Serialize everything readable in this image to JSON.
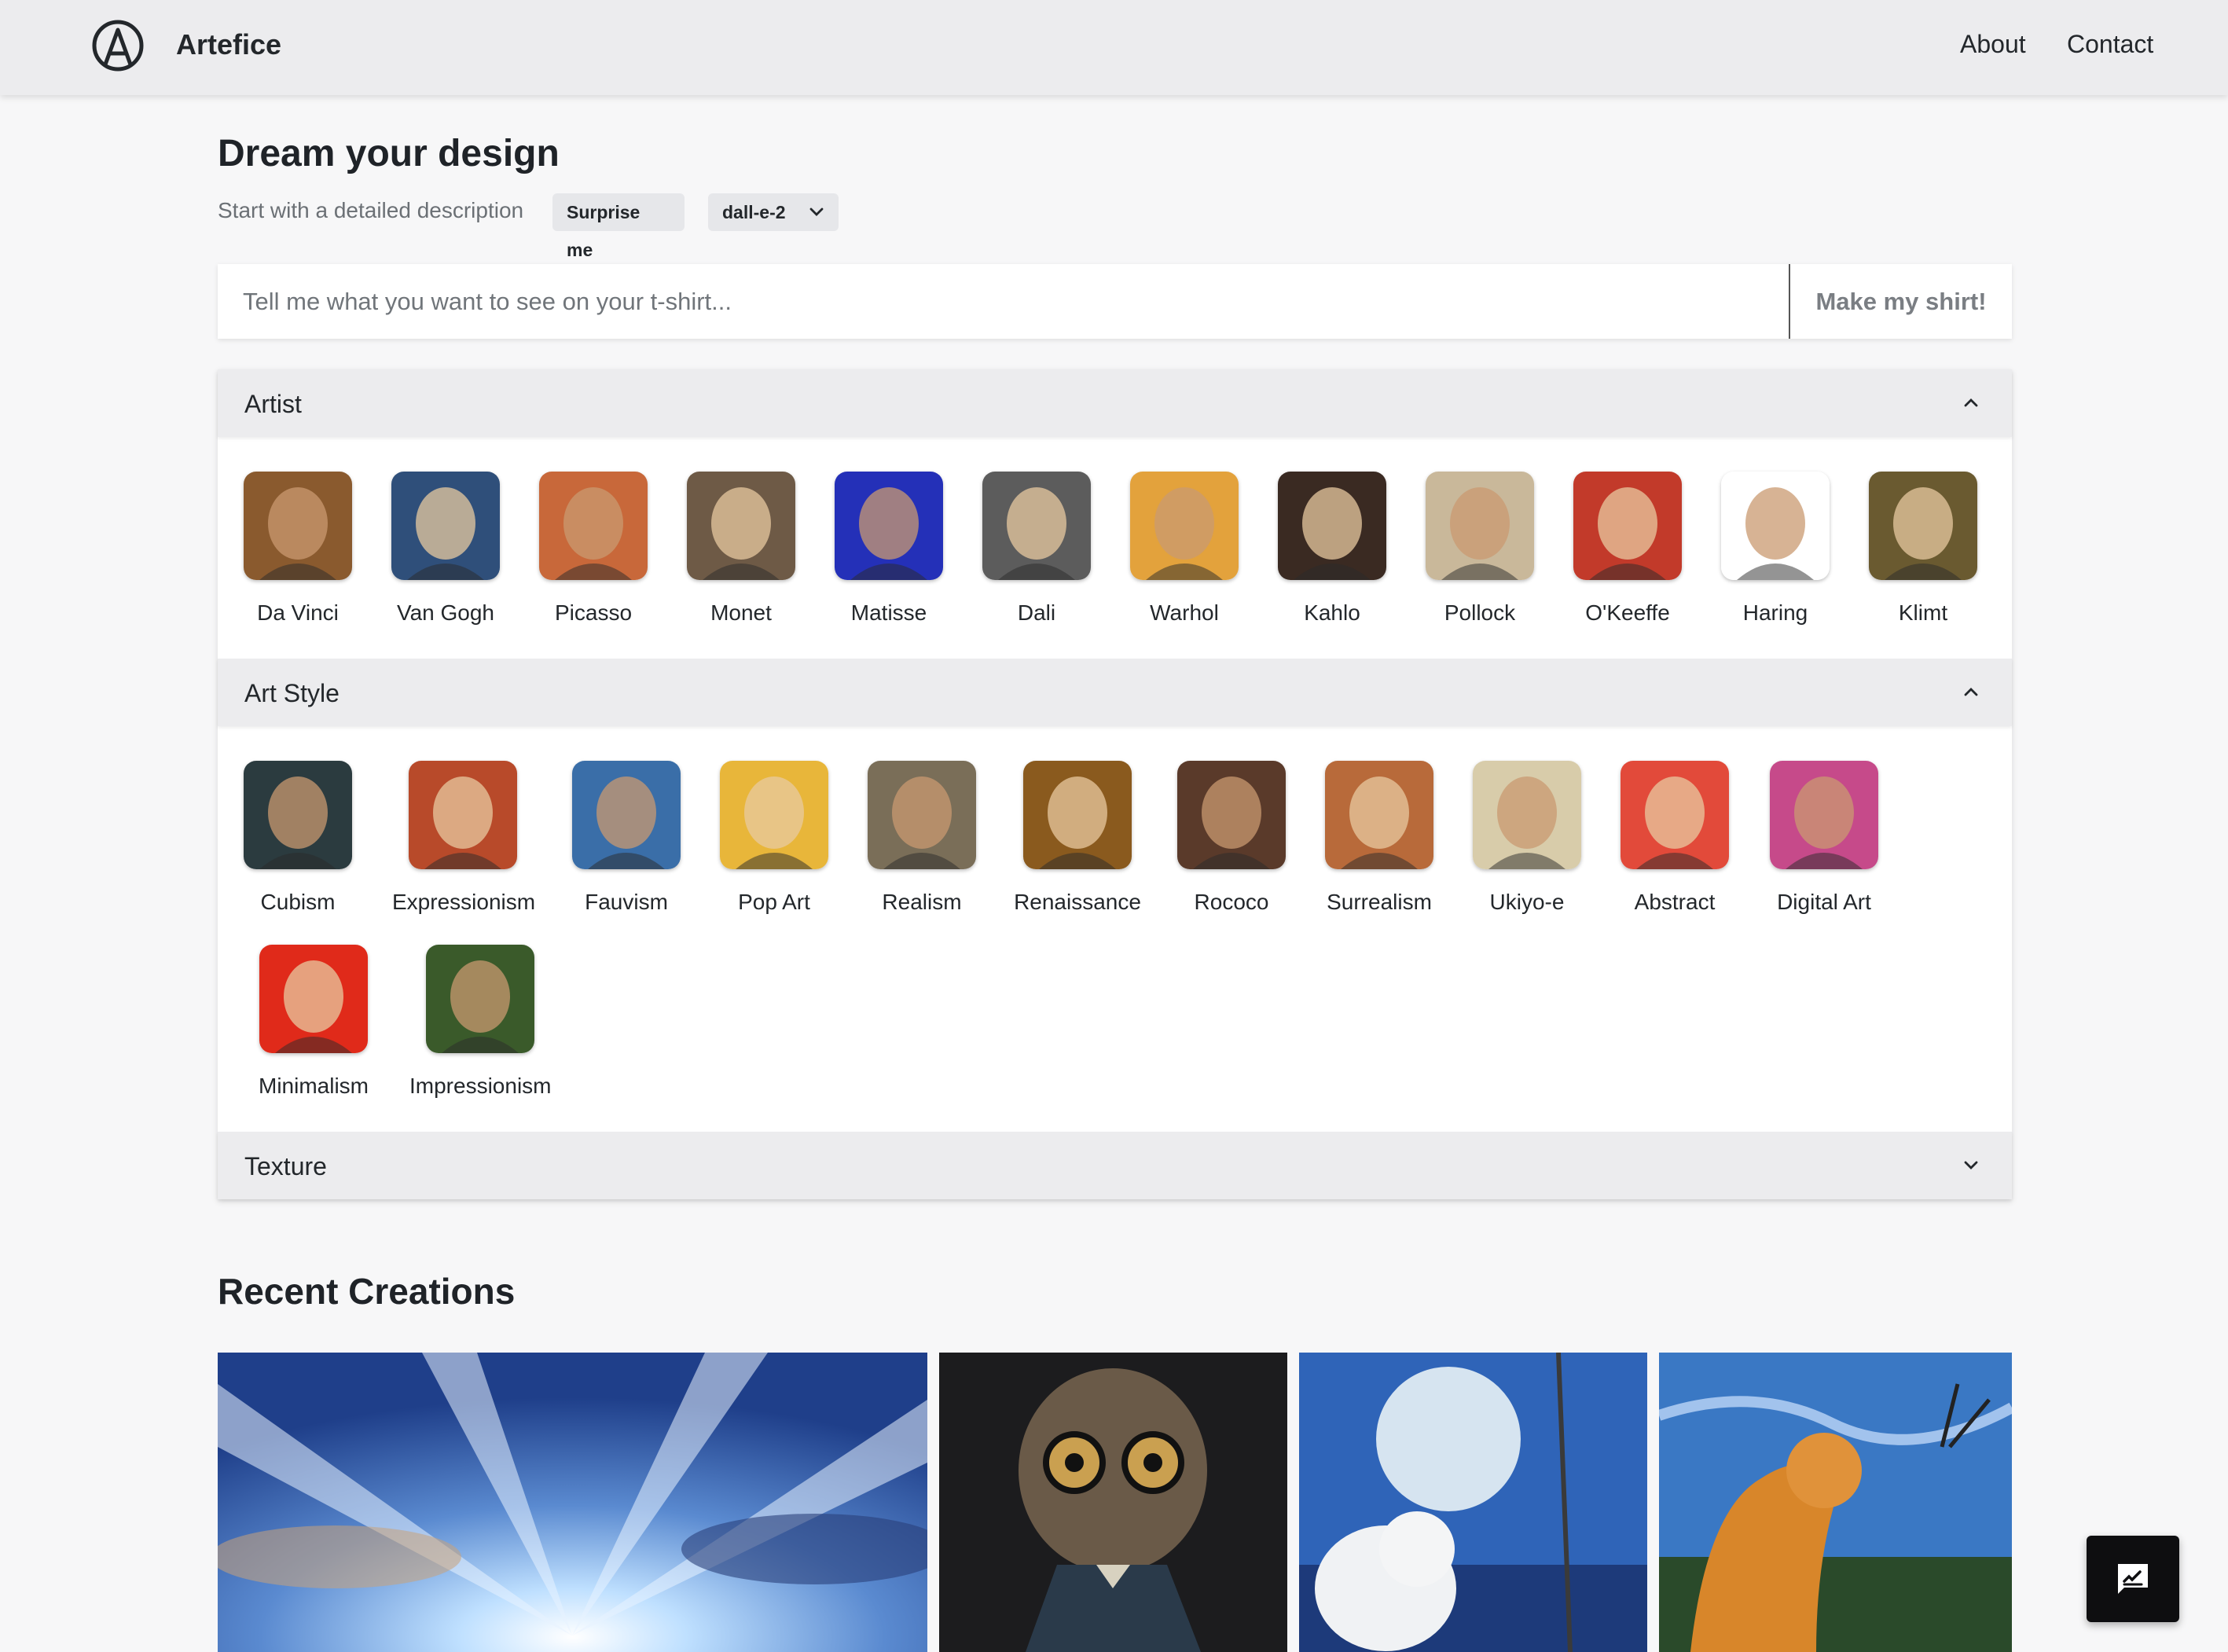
{
  "header": {
    "brand": "Artefice",
    "nav": {
      "about": "About",
      "contact": "Contact"
    }
  },
  "hero": {
    "title": "Dream your design",
    "subtitle": "Start with a detailed description",
    "surprise_label": "Surprise me",
    "model_selected": "dall-e-2"
  },
  "prompt": {
    "placeholder": "Tell me what you want to see on your t-shirt...",
    "value": "",
    "submit_label": "Make my shirt!"
  },
  "sections": {
    "artist": {
      "title": "Artist",
      "expanded": true,
      "items": [
        {
          "label": "Da Vinci",
          "color": "#8a5a2e"
        },
        {
          "label": "Van Gogh",
          "color": "#2f4f7a"
        },
        {
          "label": "Picasso",
          "color": "#c8683a"
        },
        {
          "label": "Monet",
          "color": "#6e5a46"
        },
        {
          "label": "Matisse",
          "color": "#2430b8"
        },
        {
          "label": "Dali",
          "color": "#5c5c5c"
        },
        {
          "label": "Warhol",
          "color": "#e3a23c"
        },
        {
          "label": "Kahlo",
          "color": "#3a2a22"
        },
        {
          "label": "Pollock",
          "color": "#c9b89a"
        },
        {
          "label": "O'Keeffe",
          "color": "#c23a2a"
        },
        {
          "label": "Haring",
          "color": "#ffffff"
        },
        {
          "label": "Klimt",
          "color": "#6a5a30"
        }
      ]
    },
    "art_style": {
      "title": "Art Style",
      "expanded": true,
      "items": [
        {
          "label": "Cubism",
          "color": "#2b3b3f"
        },
        {
          "label": "Expressionism",
          "color": "#b84a2a"
        },
        {
          "label": "Fauvism",
          "color": "#3a6ea8"
        },
        {
          "label": "Pop Art",
          "color": "#e8b63a"
        },
        {
          "label": "Realism",
          "color": "#7a6e58"
        },
        {
          "label": "Renaissance",
          "color": "#8a5a1e"
        },
        {
          "label": "Rococo",
          "color": "#5a3a2a"
        },
        {
          "label": "Surrealism",
          "color": "#b86a3a"
        },
        {
          "label": "Ukiyo-e",
          "color": "#d8ccaa"
        },
        {
          "label": "Abstract",
          "color": "#e24a3a"
        },
        {
          "label": "Digital Art",
          "color": "#c64a8a"
        },
        {
          "label": "Minimalism",
          "color": "#e02a1a"
        },
        {
          "label": "Impressionism",
          "color": "#3a5a2a"
        }
      ]
    },
    "texture": {
      "title": "Texture",
      "expanded": false
    }
  },
  "recent": {
    "title": "Recent Creations",
    "images": [
      {
        "name": "sky-burst",
        "color": "#3a6ab8"
      },
      {
        "name": "owl-glasses",
        "color": "#2a2a2a"
      },
      {
        "name": "dog-moon",
        "color": "#2a5ab8"
      },
      {
        "name": "cat-starry",
        "color": "#3a7ac8"
      }
    ]
  },
  "colors": {
    "background": "#f7f7f8",
    "topbar": "#ececee",
    "accordion_header": "#ececee",
    "chip": "#e6e7ea",
    "fab": "#0e0e10"
  },
  "icons": {
    "logo": "circle-a-logo-icon",
    "model_dropdown": "chevron-down-icon",
    "section_expanded": "chevron-up-icon",
    "section_collapsed": "chevron-down-icon",
    "feedback": "feedback-chat-icon"
  }
}
